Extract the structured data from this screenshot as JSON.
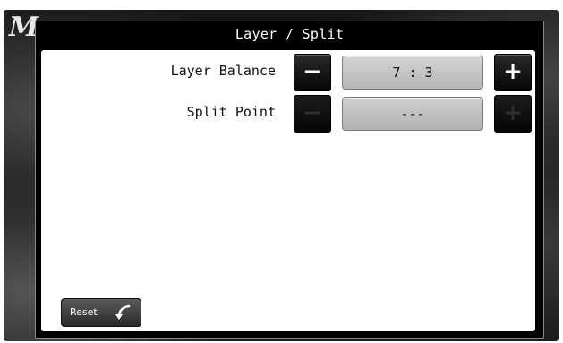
{
  "background": {
    "logo_text": "M"
  },
  "dialog": {
    "title": "Layer / Split"
  },
  "rows": [
    {
      "label": "Layer Balance",
      "value": "7 : 3",
      "minus": "−",
      "plus": "+",
      "enabled": true
    },
    {
      "label": "Split Point",
      "value": "---",
      "minus": "−",
      "plus": "+",
      "enabled": false
    }
  ],
  "footer": {
    "reset_label": "Reset",
    "reset_icon": "undo-arrow-icon"
  }
}
